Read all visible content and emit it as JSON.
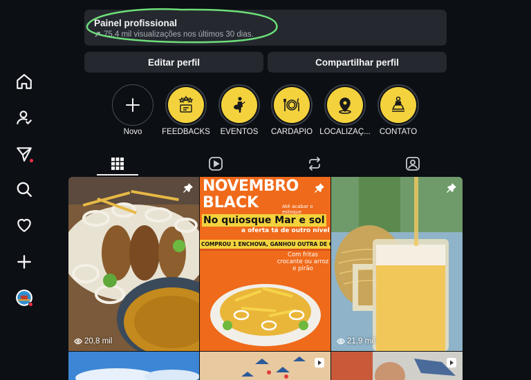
{
  "dashboard": {
    "title": "Painel profissional",
    "subtitle": "75,4 mil visualizações nos últimos 30 dias."
  },
  "actions": {
    "edit_label": "Editar perfil",
    "share_label": "Compartilhar perfil"
  },
  "highlights": [
    {
      "label": "Novo",
      "icon": "plus-icon"
    },
    {
      "label": "FEEDBACKS",
      "icon": "feedback-stars-icon"
    },
    {
      "label": "EVENTOS",
      "icon": "musician-icon"
    },
    {
      "label": "CARDÁPIO",
      "icon": "plate-cutlery-icon"
    },
    {
      "label": "LOCALIZAÇ...",
      "icon": "location-pin-icon"
    },
    {
      "label": "CONTATO",
      "icon": "service-bell-icon"
    }
  ],
  "tabs": [
    {
      "name": "posts-grid",
      "icon": "grid-icon",
      "active": true
    },
    {
      "name": "reels",
      "icon": "reels-icon",
      "active": false
    },
    {
      "name": "reposts",
      "icon": "repost-icon",
      "active": false
    },
    {
      "name": "tagged",
      "icon": "tagged-user-icon",
      "active": false
    }
  ],
  "rail": [
    "home-icon",
    "people-icon",
    "messages-icon",
    "search-icon",
    "heart-icon",
    "create-icon",
    "profile-avatar"
  ],
  "posts": [
    {
      "views": "20,8 mil",
      "pinned": true,
      "subject": "fried fish platter with onions and pirão"
    },
    {
      "pinned": true,
      "poster": {
        "headline1": "NOVEMBRO",
        "headline2": "BLACK",
        "note": "Até acabar o estoque",
        "place": "No quiosque Mar e sol",
        "tagline": "a oferta tá de outro nível",
        "offer": "COMPROU 1 ENCHOVA, GANHOU OUTRA DE GRAÇA",
        "sides": "Com fritas crocante ou arroz e pirão"
      }
    },
    {
      "views": "21,9 mil",
      "pinned": true,
      "subject": "beer glass with pasta"
    }
  ],
  "colors": {
    "background": "#0c0f14",
    "card": "#25292f",
    "highlight_yellow": "#f4d23d",
    "notification": "#ff3040",
    "scribble": "#6ee07a",
    "poster_orange": "#ef6a1a"
  }
}
